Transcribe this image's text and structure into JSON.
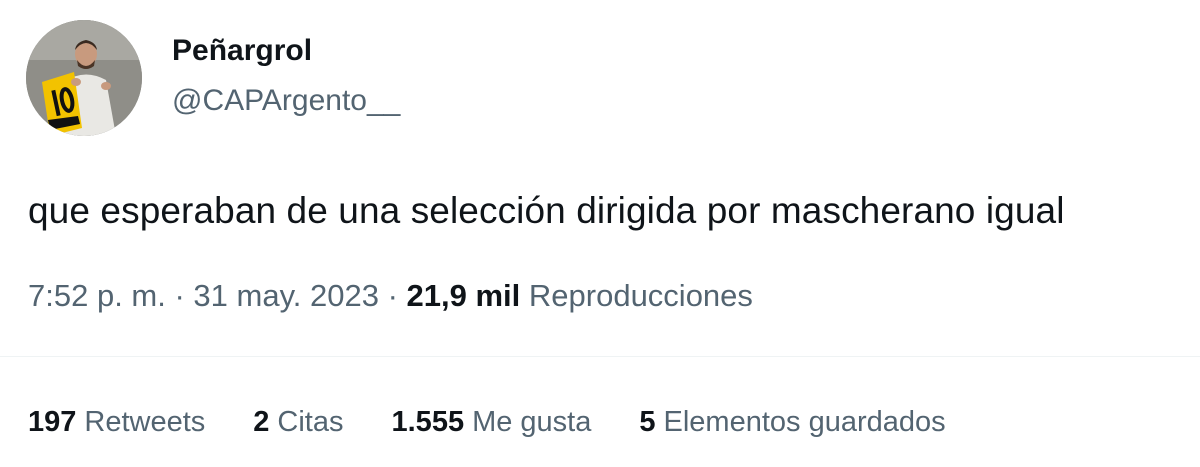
{
  "user": {
    "display_name": "Peñargrol",
    "handle": "@CAPArgento__"
  },
  "tweet": {
    "text": "que esperaban de una selección dirigida por mascherano igual",
    "time": "7:52 p. m.",
    "date": "31 may. 2023",
    "views_count": "21,9 mil",
    "views_label": "Reproducciones",
    "separator": "·"
  },
  "stats": [
    {
      "count": "197",
      "label": "Retweets"
    },
    {
      "count": "2",
      "label": "Citas"
    },
    {
      "count": "1.555",
      "label": "Me gusta"
    },
    {
      "count": "5",
      "label": "Elementos guardados"
    }
  ],
  "colors": {
    "primary_text": "#0f1419",
    "secondary_text": "#536471",
    "divider": "#eff3f4",
    "jersey_yellow": "#f2c200"
  }
}
